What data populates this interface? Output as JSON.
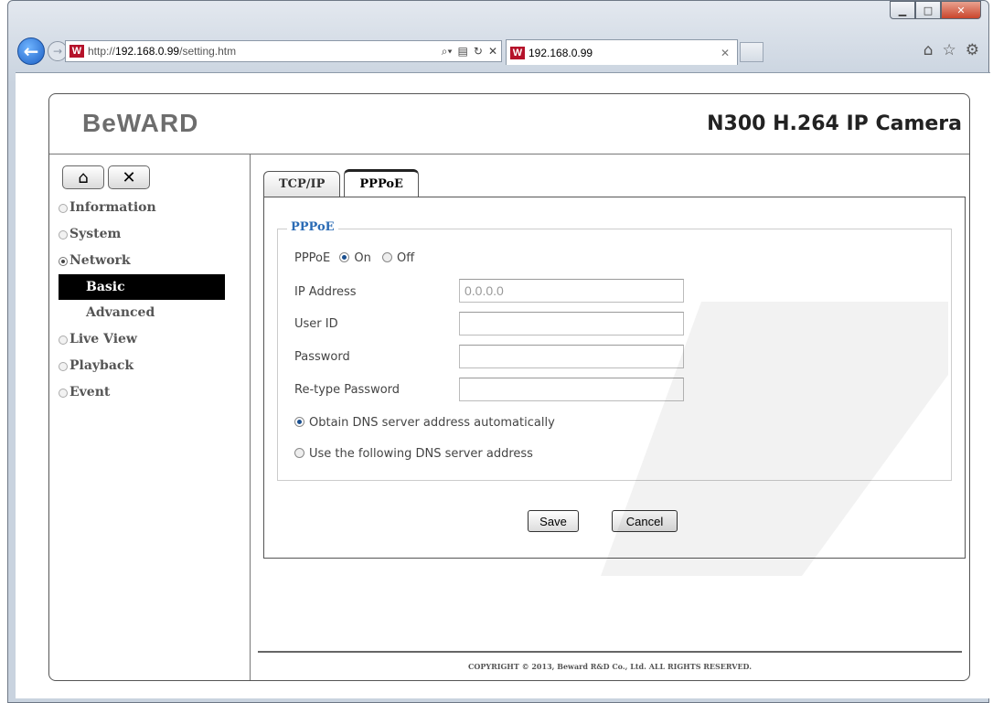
{
  "browser": {
    "url_prefix": "http://",
    "url_host": "192.168.0.99",
    "url_path": "/setting.htm",
    "tab_title": "192.168.0.99"
  },
  "camera": {
    "logo_text": "BeWARD",
    "product_title": "N300 H.264 IP Camera"
  },
  "sidebar": {
    "items": [
      {
        "label": "Information",
        "expanded": false
      },
      {
        "label": "System",
        "expanded": false
      },
      {
        "label": "Network",
        "expanded": true
      },
      {
        "label": "Live View",
        "expanded": false
      },
      {
        "label": "Playback",
        "expanded": false
      },
      {
        "label": "Event",
        "expanded": false
      }
    ],
    "network_sub": [
      {
        "label": "Basic",
        "active": true
      },
      {
        "label": "Advanced",
        "active": false
      }
    ]
  },
  "tabs": [
    {
      "label": "TCP/IP",
      "active": false
    },
    {
      "label": "PPPoE",
      "active": true
    }
  ],
  "form": {
    "legend": "PPPoE",
    "pppoe_label": "PPPoE",
    "on_label": "On",
    "off_label": "Off",
    "pppoe_state": "On",
    "ip_label": "IP Address",
    "ip_value": "0.0.0.0",
    "user_label": "User ID",
    "user_value": "",
    "password_label": "Password",
    "password_value": "",
    "retype_label": "Re-type Password",
    "retype_value": "",
    "dns_auto_label": "Obtain DNS server address automatically",
    "dns_manual_label": "Use the following DNS server address",
    "dns_mode": "auto",
    "save_label": "Save",
    "cancel_label": "Cancel"
  },
  "footer": {
    "copyright": "COPYRIGHT © 2013, Beward R&D Co., Ltd. ALL RIGHTS RESERVED."
  },
  "colors": {
    "legend": "#2a6bb5",
    "active_menu_bg": "#000000",
    "favicon": "#b5122a"
  }
}
